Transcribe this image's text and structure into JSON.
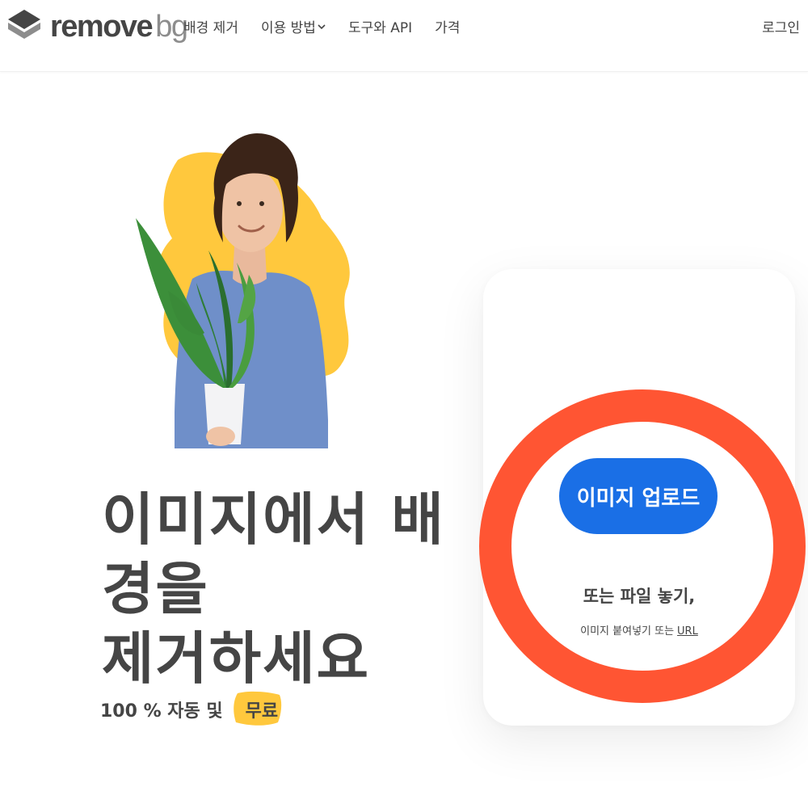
{
  "header": {
    "logo": {
      "main": "remove",
      "suffix": "bg"
    },
    "nav": [
      {
        "label": "배경 제거",
        "dropdown": false
      },
      {
        "label": "이용 방법",
        "dropdown": true
      },
      {
        "label": "도구와 API",
        "dropdown": false
      },
      {
        "label": "가격",
        "dropdown": false
      }
    ],
    "login_label": "로그인"
  },
  "hero": {
    "headline_line1": "이미지에서 배경을",
    "headline_line2": "제거하세요",
    "subline_prefix": "100 % 자동 및",
    "subline_badge": "무료"
  },
  "upload": {
    "button_label": "이미지 업로드",
    "drop_title": "또는 파일 놓기,",
    "drop_sub_prefix": "이미지 붙여넣기 또는",
    "drop_sub_link": "URL"
  },
  "colors": {
    "accent": "#1a6fe6",
    "badge_yellow": "#ffc83d",
    "blob_yellow": "#ffc83d",
    "annotation_ring": "#ff5533",
    "text": "#454545"
  }
}
